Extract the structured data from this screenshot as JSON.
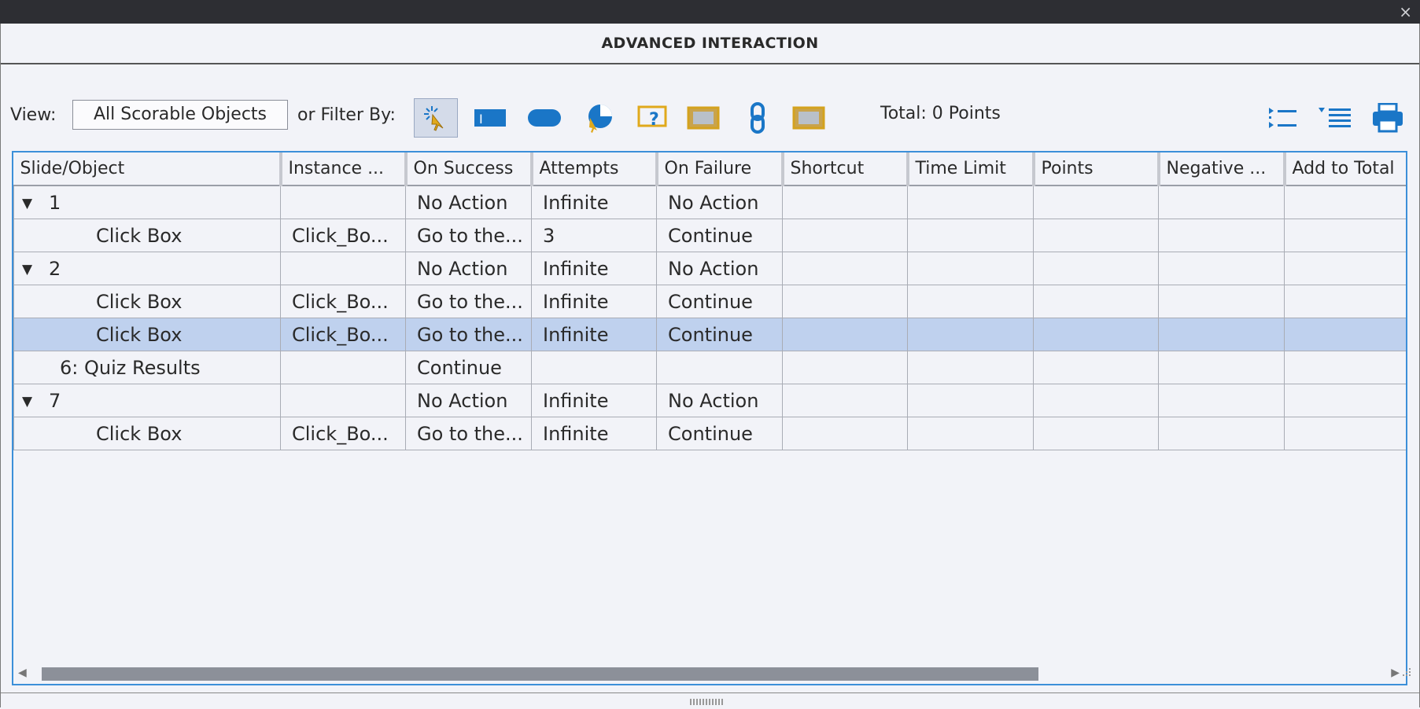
{
  "window": {
    "title": "ADVANCED INTERACTION",
    "close_glyph": "×"
  },
  "toolbar": {
    "view_label": "View:",
    "view_value": "All Scorable Objects",
    "filter_label": "or Filter By:",
    "total_label": "Total: 0 Points",
    "filter_icons": [
      "click-box-icon",
      "text-entry-box-icon",
      "button-icon",
      "rollover-slidelet-icon",
      "question-icon",
      "image-icon",
      "hyperlink-icon",
      "smart-shape-icon"
    ],
    "tool_icons": [
      "expand-all-icon",
      "collapse-all-icon",
      "print-icon"
    ],
    "accent_color": "#1a76c7",
    "highlight_color": "#d4a21e"
  },
  "grid": {
    "columns": [
      "Slide/Object",
      "Instance ...",
      "On Success",
      "Attempts",
      "On Failure",
      "Shortcut",
      "Time Limit",
      "Points",
      "Negative ...",
      "Add to Total"
    ],
    "rows": [
      {
        "expander": "▼",
        "slide": "1",
        "instance": "",
        "on_success": "No Action",
        "attempts": "Infinite",
        "on_failure": "No Action",
        "level": 0
      },
      {
        "expander": "",
        "slide": "Click Box",
        "instance": "Click_Bo...",
        "on_success": "Go to the...",
        "attempts": "3",
        "on_failure": "Continue",
        "level": 1
      },
      {
        "expander": "▼",
        "slide": "2",
        "instance": "",
        "on_success": "No Action",
        "attempts": "Infinite",
        "on_failure": "No Action",
        "level": 0
      },
      {
        "expander": "",
        "slide": "Click Box",
        "instance": "Click_Bo...",
        "on_success": "Go to the...",
        "attempts": "Infinite",
        "on_failure": "Continue",
        "level": 1
      },
      {
        "expander": "",
        "slide": "Click Box",
        "instance": "Click_Bo...",
        "on_success": "Go to the...",
        "attempts": "Infinite",
        "on_failure": "Continue",
        "level": 1,
        "selected": true
      },
      {
        "expander": "",
        "slide": "6: Quiz Results",
        "instance": "",
        "on_success": "Continue",
        "attempts": "",
        "on_failure": "",
        "level": 2
      },
      {
        "expander": "▼",
        "slide": "7",
        "instance": "",
        "on_success": "No Action",
        "attempts": "Infinite",
        "on_failure": "No Action",
        "level": 0
      },
      {
        "expander": "",
        "slide": "Click Box",
        "instance": "Click_Bo...",
        "on_success": "Go to the...",
        "attempts": "Infinite",
        "on_failure": "Continue",
        "level": 1
      }
    ],
    "selected_row_color": "#bfd1ee",
    "border_color": "#3c8fd9"
  },
  "scrollbar": {
    "left_arrow": "◀",
    "right_arrow": "▶",
    "thumb_fraction": 0.72
  }
}
